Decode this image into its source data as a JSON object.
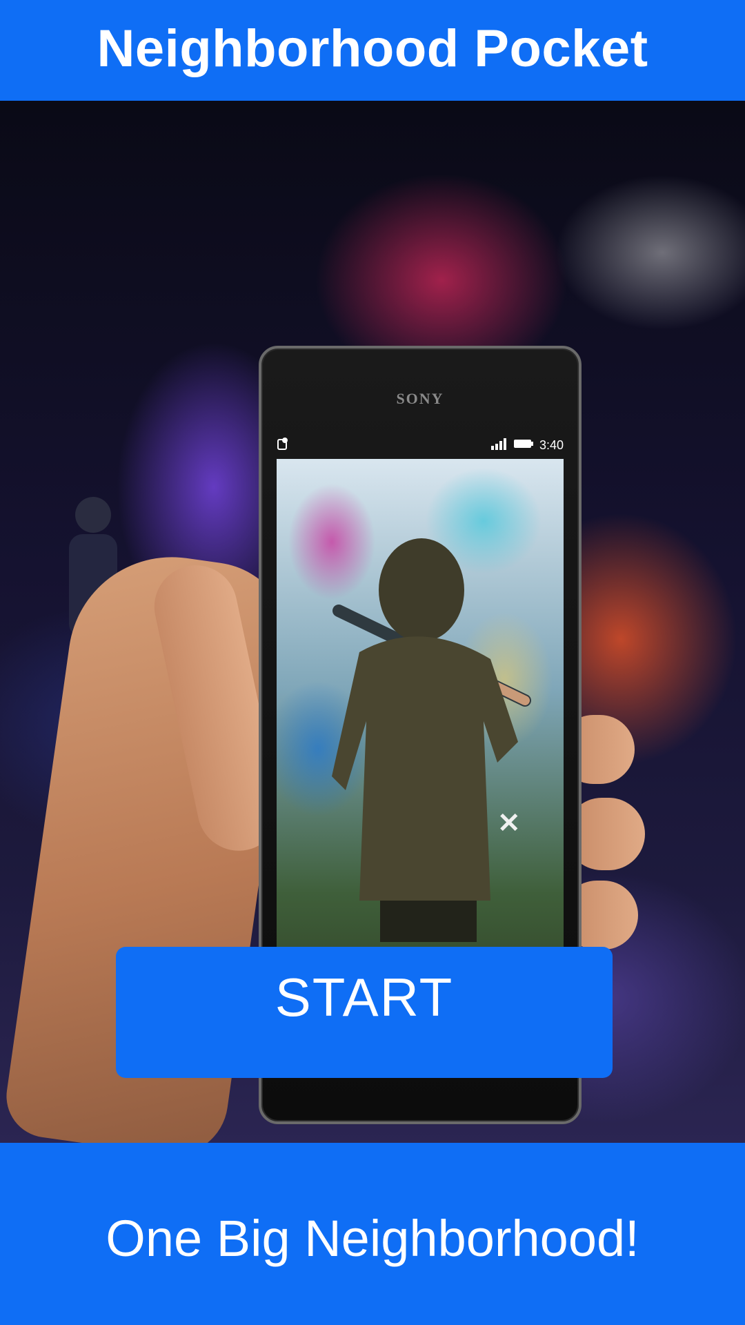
{
  "header": {
    "title": "Neighborhood Pocket"
  },
  "hero": {
    "phone_brand": "SONY",
    "phone_time": "3:40"
  },
  "actions": {
    "start_label": "START"
  },
  "footer": {
    "tagline": "One Big Neighborhood!"
  },
  "colors": {
    "primary_blue": "#0f6ef5",
    "text_white": "#ffffff"
  },
  "icons": [
    "signal-icon",
    "battery-icon",
    "notification-icon",
    "close-icon"
  ]
}
